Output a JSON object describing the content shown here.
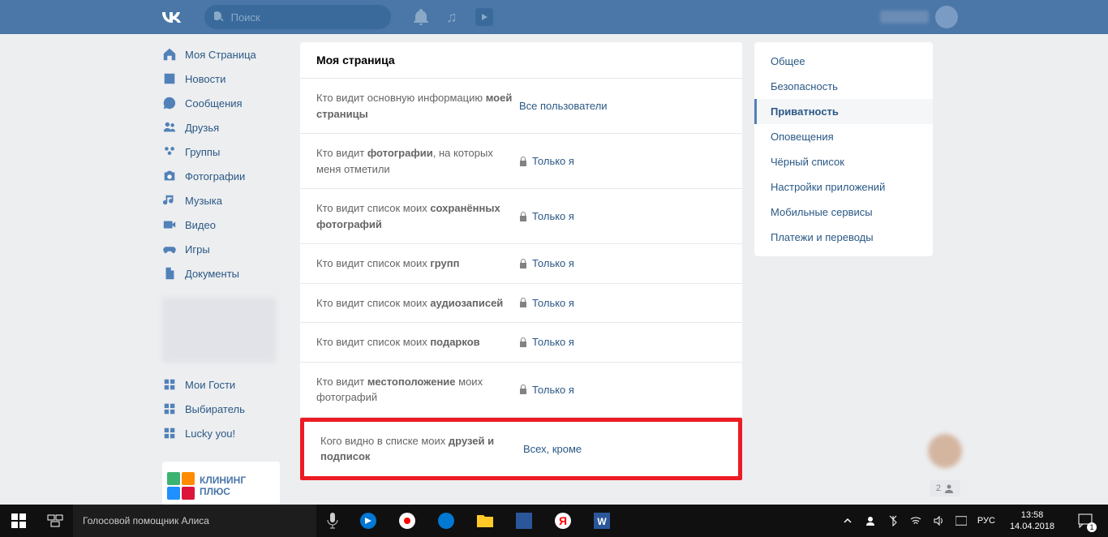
{
  "header": {
    "search_placeholder": "Поиск"
  },
  "sidebar": {
    "items": [
      {
        "label": "Моя Страница",
        "icon": "home"
      },
      {
        "label": "Новости",
        "icon": "news"
      },
      {
        "label": "Сообщения",
        "icon": "messages"
      },
      {
        "label": "Друзья",
        "icon": "friends"
      },
      {
        "label": "Группы",
        "icon": "groups"
      },
      {
        "label": "Фотографии",
        "icon": "photos"
      },
      {
        "label": "Музыка",
        "icon": "music"
      },
      {
        "label": "Видео",
        "icon": "video"
      },
      {
        "label": "Игры",
        "icon": "games"
      },
      {
        "label": "Документы",
        "icon": "documents"
      }
    ],
    "apps": [
      {
        "label": "Мои Гости"
      },
      {
        "label": "Выбиратель"
      },
      {
        "label": "Lucky you!"
      }
    ],
    "ad": {
      "title": "КЛИНИНГ ПЛЮС"
    }
  },
  "main": {
    "title": "Моя страница",
    "rows": [
      {
        "label_pre": "Кто видит основную информацию ",
        "label_bold": "моей страницы",
        "label_post": "",
        "value": "Все пользователи",
        "lock": false
      },
      {
        "label_pre": "Кто видит ",
        "label_bold": "фотографии",
        "label_post": ", на которых меня отметили",
        "value": "Только я",
        "lock": true
      },
      {
        "label_pre": "Кто видит список моих ",
        "label_bold": "сохранённых фотографий",
        "label_post": "",
        "value": "Только я",
        "lock": true
      },
      {
        "label_pre": "Кто видит список моих ",
        "label_bold": "групп",
        "label_post": "",
        "value": "Только я",
        "lock": true
      },
      {
        "label_pre": "Кто видит список моих ",
        "label_bold": "аудиозаписей",
        "label_post": "",
        "value": "Только я",
        "lock": true
      },
      {
        "label_pre": "Кто видит список моих ",
        "label_bold": "подарков",
        "label_post": "",
        "value": "Только я",
        "lock": true
      },
      {
        "label_pre": "Кто видит ",
        "label_bold": "местоположение",
        "label_post": " моих фотографий",
        "value": "Только я",
        "lock": true
      },
      {
        "label_pre": "Кого видно в списке моих ",
        "label_bold": "друзей и подписок",
        "label_post": "",
        "value": "Всех, кроме",
        "lock": false
      }
    ]
  },
  "settings_tabs": [
    {
      "label": "Общее",
      "active": false
    },
    {
      "label": "Безопасность",
      "active": false
    },
    {
      "label": "Приватность",
      "active": true
    },
    {
      "label": "Оповещения",
      "active": false
    },
    {
      "label": "Чёрный список",
      "active": false
    },
    {
      "label": "Настройки приложений",
      "active": false
    },
    {
      "label": "Мобильные сервисы",
      "active": false
    },
    {
      "label": "Платежи и переводы",
      "active": false
    }
  ],
  "counter_value": "2",
  "taskbar": {
    "cortana": "Голосовой помощник Алиса",
    "lang": "РУС",
    "time": "13:58",
    "date": "14.04.2018",
    "notif_count": "1"
  }
}
